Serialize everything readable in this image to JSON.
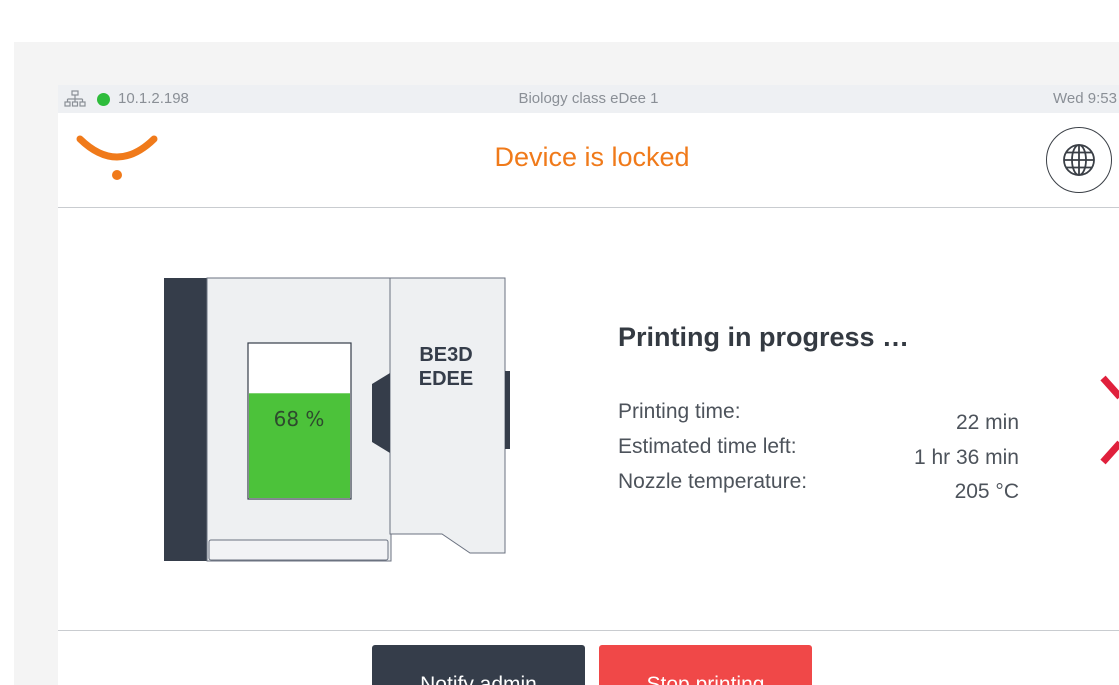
{
  "status_bar": {
    "ip": "10.1.2.198",
    "device_name": "Biology class eDee 1",
    "time": "Wed 9:53",
    "connection_color": "#2ebc3b"
  },
  "header": {
    "title": "Device is locked",
    "accent_color": "#f07a1a",
    "language_icon": "globe-icon"
  },
  "printer": {
    "brand_line1": "BE3D",
    "brand_line2": "EDEE",
    "progress_label": "68 %",
    "progress": 0.68,
    "progress_color": "#4cc23a"
  },
  "status": {
    "title": "Printing in progress …",
    "rows": [
      {
        "label": "Printing time:",
        "value": "22 min"
      },
      {
        "label": "Estimated time left:",
        "value": "1 hr 36 min"
      },
      {
        "label": "Nozzle temperature:",
        "value": "205 °C"
      }
    ]
  },
  "actions": {
    "notify_label": "Notify admin",
    "stop_label": "Stop printing",
    "stop_color": "#f04848"
  }
}
